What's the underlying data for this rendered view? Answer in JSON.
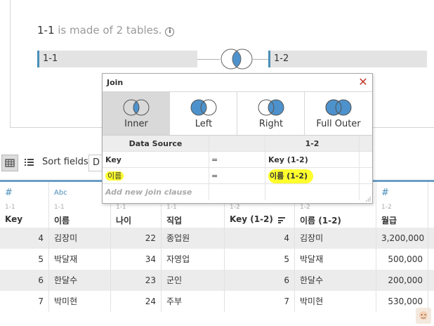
{
  "canvas": {
    "title_main": "1-1",
    "title_sub": " is made of 2 tables.",
    "info_glyph": "i",
    "left_table": "1-1",
    "right_table": "1-2"
  },
  "toolbar": {
    "sort_label": "Sort fields",
    "sort_value": "D"
  },
  "grid": {
    "columns": [
      {
        "type": "#",
        "source": "1-1",
        "name": "Key"
      },
      {
        "type": "Abc",
        "source": "1-1",
        "name": "이름"
      },
      {
        "type": "",
        "source": "1-1",
        "name": "나이"
      },
      {
        "type": "",
        "source": "1-1",
        "name": "직업"
      },
      {
        "type": "",
        "source": "1-2",
        "name": "Key (1-2)"
      },
      {
        "type": "",
        "source": "1-2",
        "name": "이름 (1-2)"
      },
      {
        "type": "#",
        "source": "1-2",
        "name": "월급"
      }
    ],
    "rows": [
      [
        "4",
        "김장미",
        "22",
        "종업원",
        "4",
        "김장미",
        "3,200,000"
      ],
      [
        "5",
        "박달재",
        "34",
        "자영업",
        "5",
        "박달재",
        "500,000"
      ],
      [
        "6",
        "한달수",
        "23",
        "군인",
        "6",
        "한달수",
        "200,000"
      ],
      [
        "7",
        "박미현",
        "24",
        "주부",
        "7",
        "박미현",
        "530,000"
      ]
    ]
  },
  "join_dialog": {
    "title": "Join",
    "join_types": [
      {
        "label": "Inner",
        "selected": true
      },
      {
        "label": "Left",
        "selected": false
      },
      {
        "label": "Right",
        "selected": false
      },
      {
        "label": "Full Outer",
        "selected": false
      }
    ],
    "clause_header": {
      "left": "Data Source",
      "right": "1-2"
    },
    "clauses": [
      {
        "left": "Key",
        "op": "=",
        "right": "Key (1-2)"
      },
      {
        "left": "이름",
        "op": "=",
        "right": "이름 (1-2)"
      }
    ],
    "add_clause": "Add new join clause"
  },
  "colors": {
    "accent_blue": "#4a8fb8",
    "venn_fill": "#4d92cc",
    "highlight": "#ffff2e",
    "close_red": "#c0392b"
  }
}
